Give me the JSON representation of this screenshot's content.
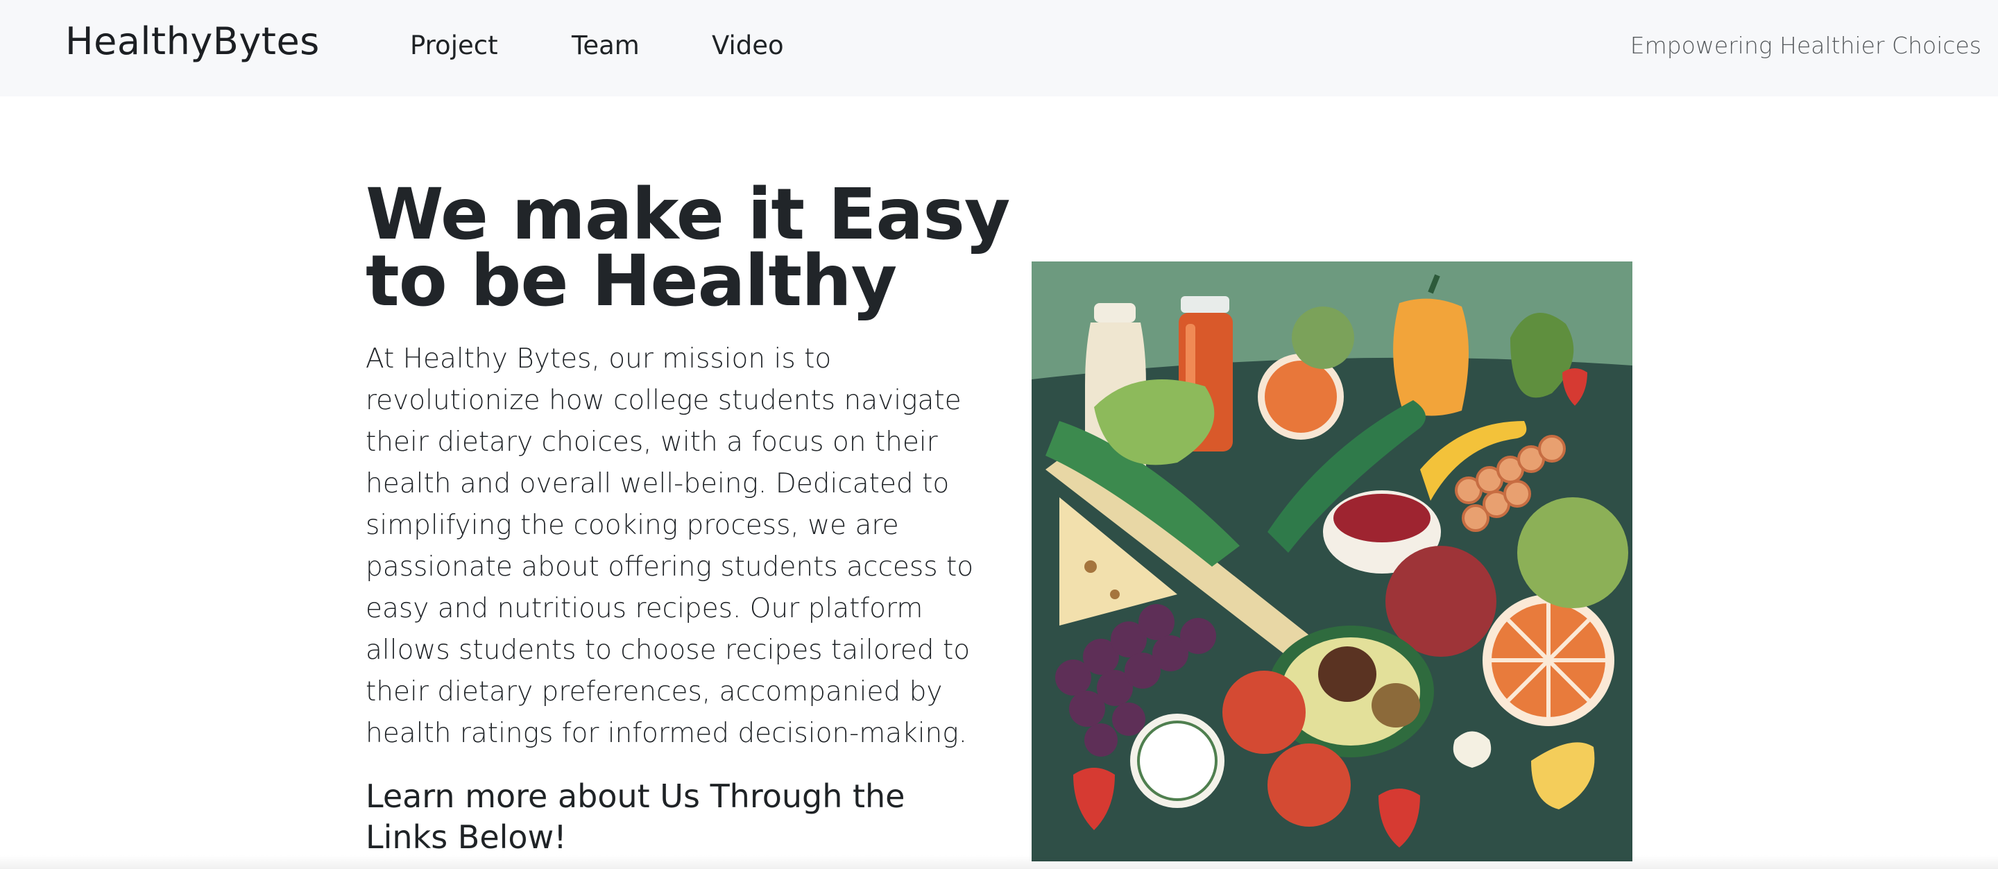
{
  "navbar": {
    "brand": "HealthyBytes",
    "links": [
      {
        "label": "Project"
      },
      {
        "label": "Team"
      },
      {
        "label": "Video"
      }
    ],
    "tagline": "Empowering Healthier Choices"
  },
  "hero": {
    "title_line1": "We make it Easy",
    "title_line2": "to be Healthy",
    "body": "At Healthy Bytes, our mission is to revolutionize how college students navigate their dietary choices, with a focus on their health and overall well-being. Dedicated to simplifying the cooking process, we are passionate about offering students access to easy and nutritious recipes. Our platform allows students to choose recipes tailored to their dietary preferences, accompanied by health ratings for informed decision-making.",
    "learn_more": "Learn more about Us Through the Links Below!"
  },
  "image": {
    "subject": "illustration of assorted fruits and vegetables"
  },
  "colors": {
    "navbar_bg": "#f7f8fa",
    "text": "#212529",
    "tagline": "#55595c",
    "image_bg": "#6d9a7f"
  }
}
